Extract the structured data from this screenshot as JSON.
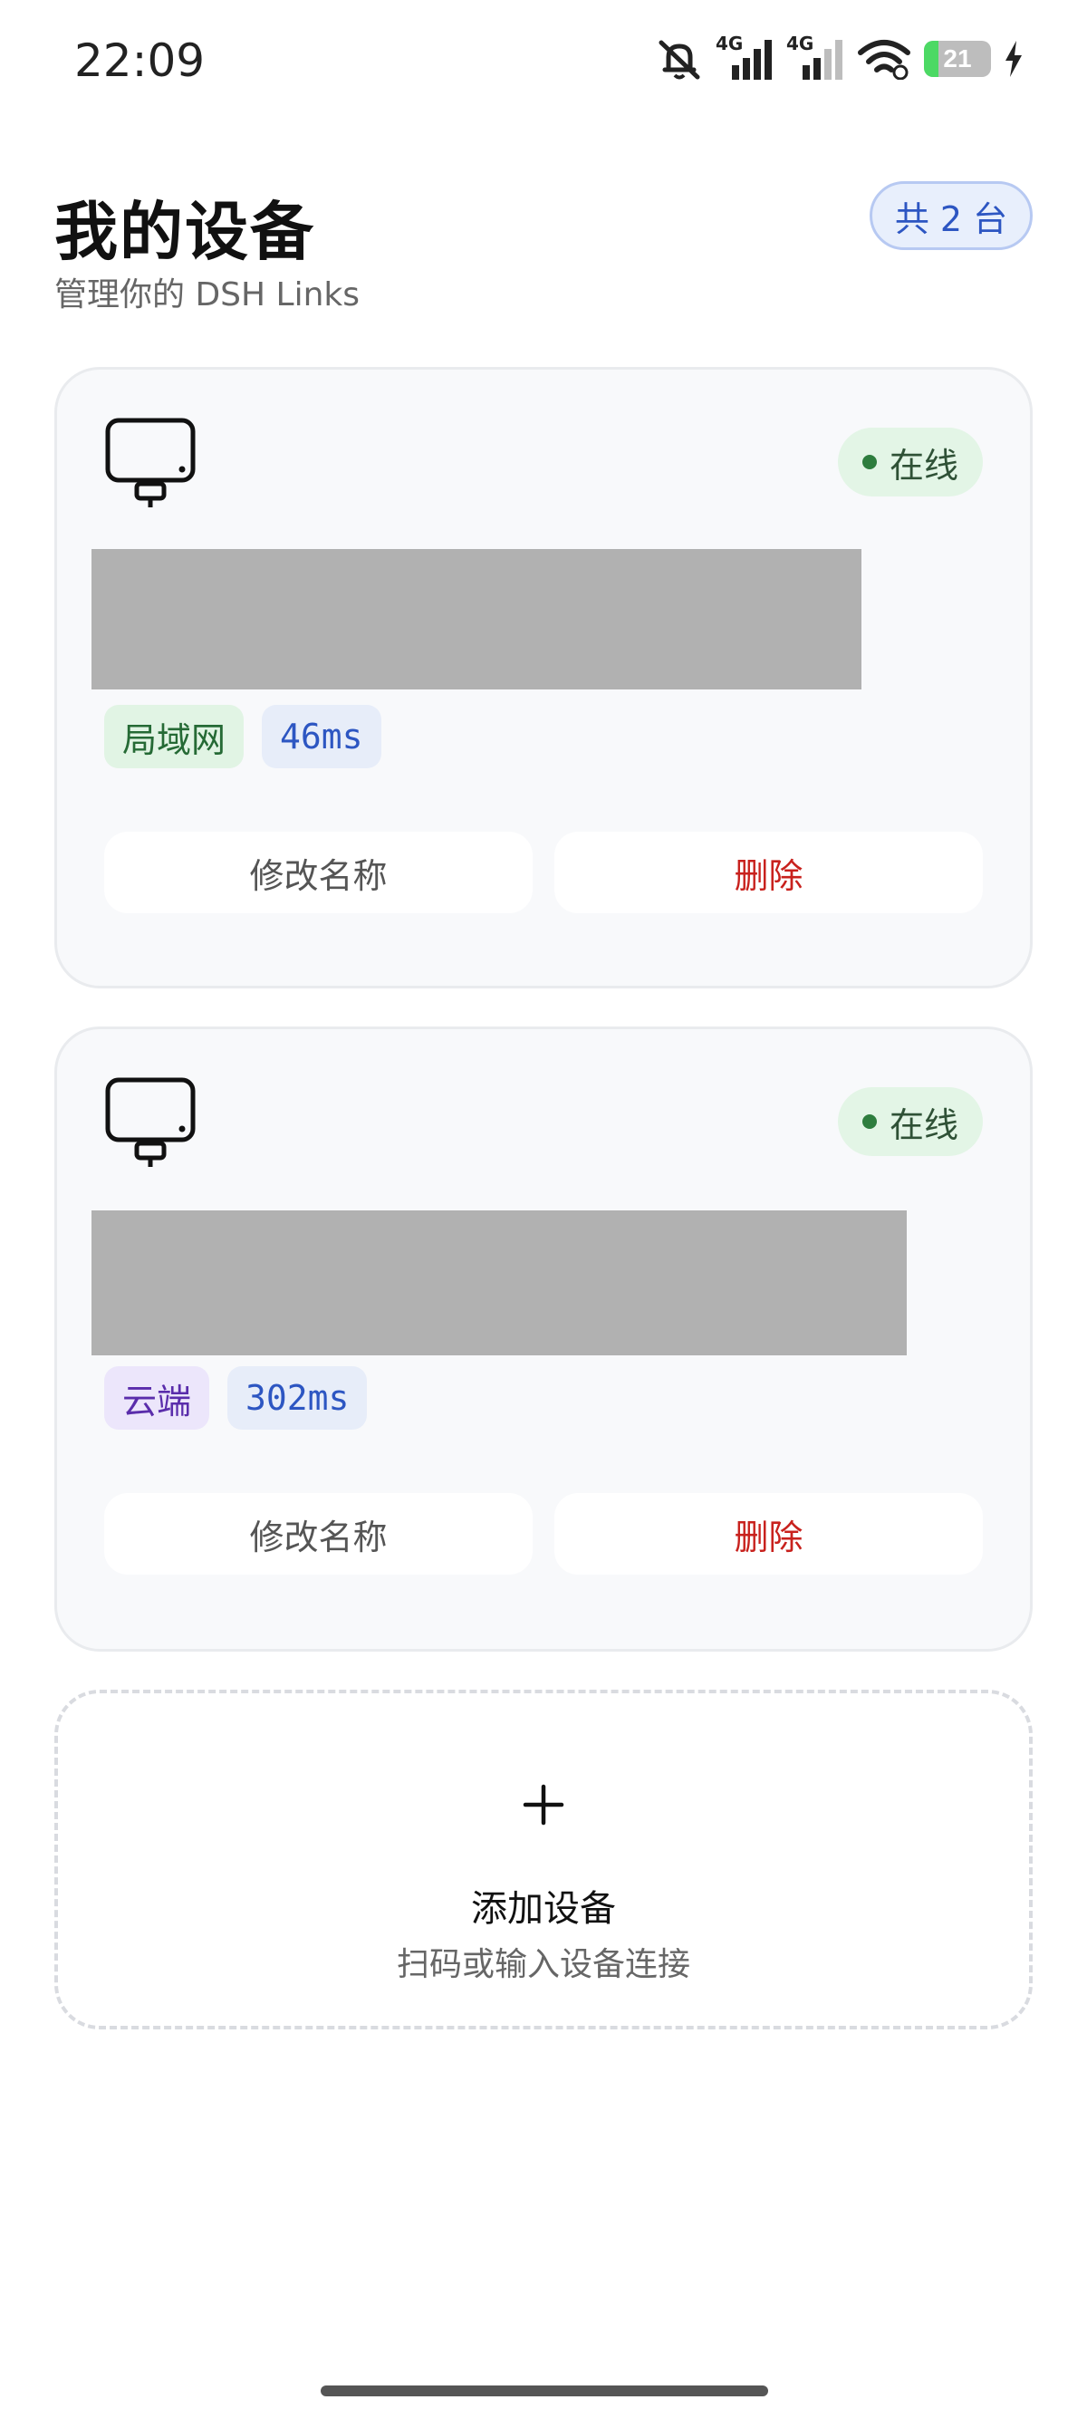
{
  "status_bar": {
    "time": "22:09",
    "network_label_1": "4G",
    "network_label_2": "4G",
    "battery": "21",
    "battery_level": 0.21,
    "icons": [
      "mute-bell-icon",
      "signal-icon",
      "signal-icon",
      "wifi-icon",
      "battery-icon",
      "charging-bolt-icon"
    ]
  },
  "header": {
    "title": "我的设备",
    "subtitle": "管理你的 DSH Links",
    "count_badge": "共 2 台"
  },
  "devices": [
    {
      "icon": "monitor-icon",
      "status": "在线",
      "connection_tag": "局域网",
      "latency": "46ms",
      "rename_label": "修改名称",
      "delete_label": "删除"
    },
    {
      "icon": "monitor-icon",
      "status": "在线",
      "connection_tag": "云端",
      "latency": "302ms",
      "rename_label": "修改名称",
      "delete_label": "删除"
    }
  ],
  "add_device": {
    "icon": "plus-icon",
    "title": "添加设备",
    "subtitle": "扫码或输入设备连接"
  },
  "colors": {
    "online": "#2e7d3e",
    "delete": "#c8211d",
    "accent": "#2d56c2"
  }
}
